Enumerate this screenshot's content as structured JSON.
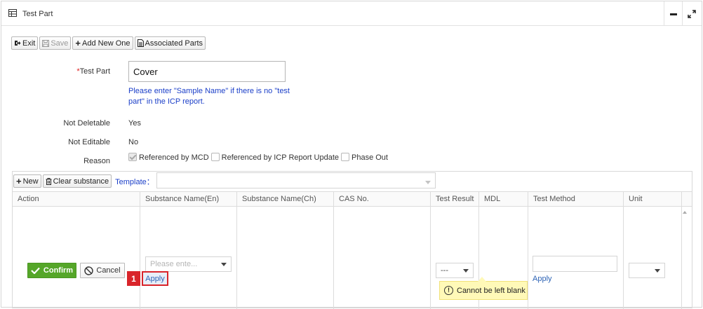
{
  "panel": {
    "title": "Test Part"
  },
  "toolbar": {
    "exit": "Exit",
    "save": "Save",
    "add_new": "Add New One",
    "associated": "Associated Parts"
  },
  "form": {
    "test_part_label": "Test Part",
    "required_mark": "*",
    "test_part_value": "Cover",
    "hint": "Please enter \"Sample Name\" if there is no \"test part\" in the ICP report.",
    "not_deletable_label": "Not Deletable",
    "not_deletable_value": "Yes",
    "not_editable_label": "Not Editable",
    "not_editable_value": "No",
    "reason_label": "Reason",
    "reasons": [
      {
        "label": "Referenced by MCD",
        "checked": true
      },
      {
        "label": "Referenced by ICP Report Update",
        "checked": false
      },
      {
        "label": "Phase Out",
        "checked": false
      }
    ]
  },
  "substance": {
    "new": "New",
    "clear": "Clear substance",
    "template_label": "Template：",
    "columns": [
      "Action",
      "Substance Name(En)",
      "Substance Name(Ch)",
      "CAS No.",
      "Test Result",
      "MDL",
      "Test Method",
      "Unit"
    ],
    "row": {
      "confirm": "Confirm",
      "cancel": "Cancel",
      "substance_placeholder": "Please ente...",
      "apply_substance": "Apply",
      "test_result_value": "---",
      "apply_method": "Apply",
      "tooltip": "Cannot be left blank",
      "step": "1"
    }
  },
  "colors": {
    "confirm": "#55a629",
    "highlight": "#d9242a",
    "link": "#1a3ec8",
    "tooltip": "#fff9b8"
  }
}
